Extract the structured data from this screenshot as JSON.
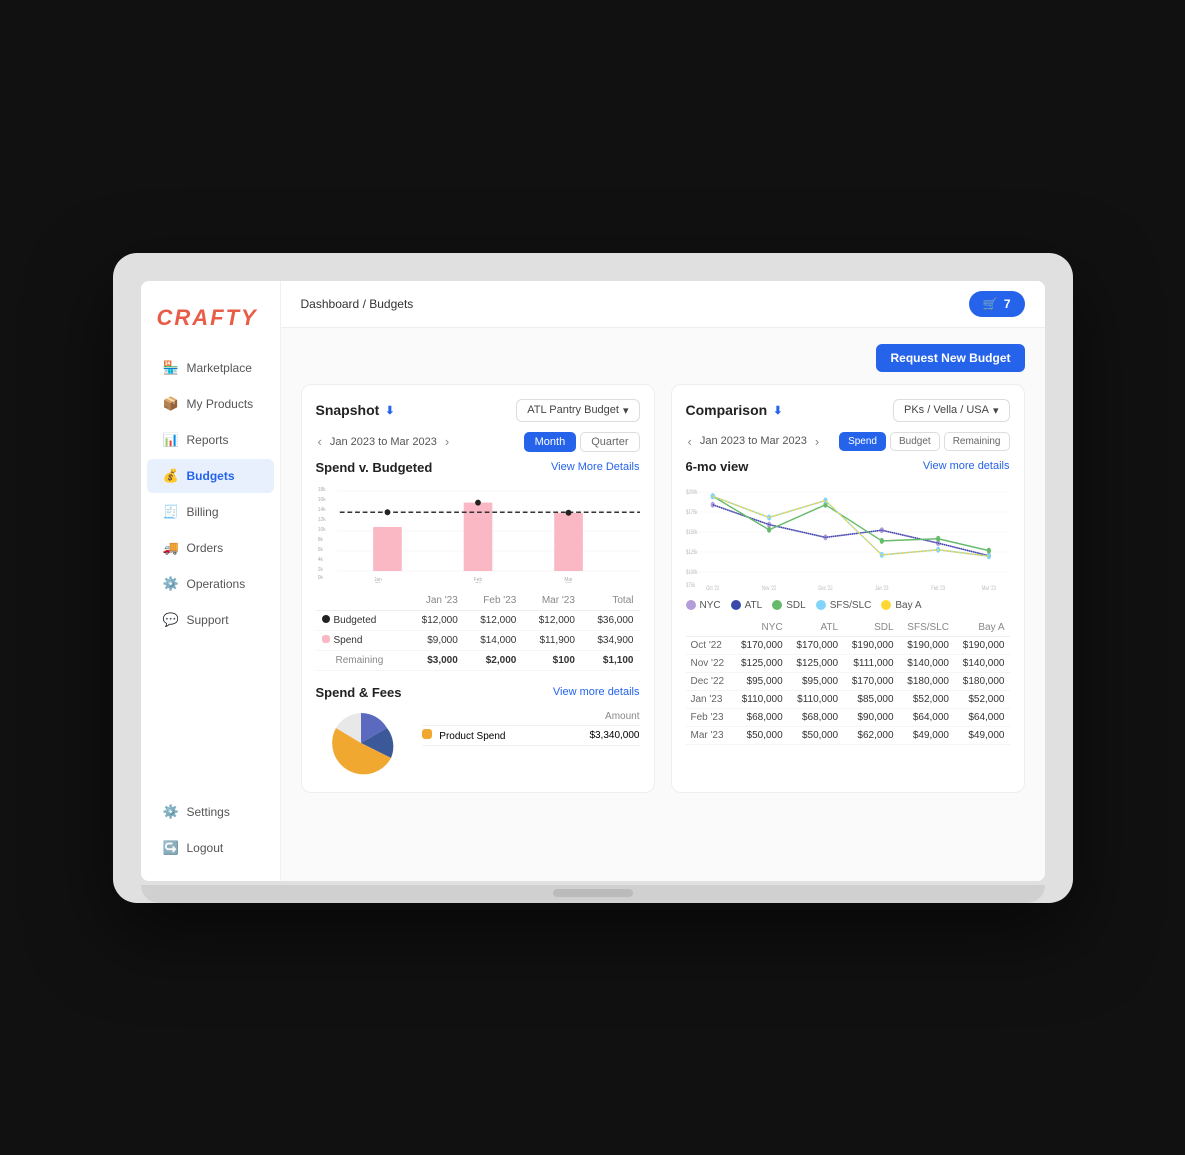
{
  "app": {
    "logo": "CRAFTY",
    "cart_count": "7"
  },
  "sidebar": {
    "nav_items": [
      {
        "id": "marketplace",
        "label": "Marketplace",
        "icon": "🏪",
        "active": false
      },
      {
        "id": "my-products",
        "label": "My Products",
        "icon": "📦",
        "active": false
      },
      {
        "id": "reports",
        "label": "Reports",
        "icon": "📊",
        "active": false
      },
      {
        "id": "budgets",
        "label": "Budgets",
        "icon": "💰",
        "active": true
      },
      {
        "id": "billing",
        "label": "Billing",
        "icon": "🧾",
        "active": false
      },
      {
        "id": "orders",
        "label": "Orders",
        "icon": "🚚",
        "active": false
      },
      {
        "id": "operations",
        "label": "Operations",
        "icon": "⚙️",
        "active": false
      },
      {
        "id": "support",
        "label": "Support",
        "icon": "💬",
        "active": false
      }
    ],
    "bottom_items": [
      {
        "id": "settings",
        "label": "Settings",
        "icon": "⚙️"
      },
      {
        "id": "logout",
        "label": "Logout",
        "icon": "↪️"
      }
    ]
  },
  "breadcrumb": {
    "parent": "Dashboard",
    "separator": "/",
    "current": "Budgets"
  },
  "header": {
    "request_btn": "Request New Budget"
  },
  "snapshot": {
    "title": "Snapshot",
    "download_label": "⬇",
    "dropdown_label": "ATL Pantry Budget",
    "date_range": "Jan 2023  to  Mar 2023",
    "tabs": [
      "Month",
      "Quarter"
    ],
    "active_tab": "Month",
    "chart_title": "Spend v. Budgeted",
    "view_more": "View More Details",
    "table": {
      "columns": [
        "",
        "Jan '23",
        "Feb '23",
        "Mar '23",
        "Total"
      ],
      "rows": [
        {
          "label": "Budgeted",
          "type": "budgeted",
          "jan": "$12,000",
          "feb": "$12,000",
          "mar": "$12,000",
          "total": "$36,000"
        },
        {
          "label": "Spend",
          "type": "spend",
          "jan": "$9,000",
          "feb": "$14,000",
          "mar": "$11,900",
          "total": "$34,900"
        },
        {
          "label": "Remaining",
          "type": "remaining",
          "jan": "$3,000",
          "feb": "$2,000",
          "mar": "$100",
          "total": "$1,100"
        }
      ]
    },
    "bar_data": [
      {
        "month": "Jan '23",
        "budgeted": 12000,
        "spend": 9000
      },
      {
        "month": "Feb '23",
        "budgeted": 12000,
        "spend": 14000
      },
      {
        "month": "Mar '23",
        "budgeted": 12000,
        "spend": 11900
      }
    ],
    "y_labels": [
      "18k",
      "16k",
      "14k",
      "12k",
      "10k",
      "8k",
      "6k",
      "4k",
      "2k",
      "0k"
    ]
  },
  "spend_fees": {
    "title": "Spend & Fees",
    "view_more": "View more details",
    "amount_label": "Amount",
    "rows": [
      {
        "color": "#f0a830",
        "label": "Product Spend",
        "amount": "$3,340,000"
      }
    ],
    "pie_segments": [
      {
        "color": "#5b6abf",
        "percent": 35
      },
      {
        "color": "#3b5998",
        "percent": 20
      },
      {
        "color": "#f0a830",
        "percent": 30
      },
      {
        "color": "#e8e8e8",
        "percent": 15
      }
    ]
  },
  "comparison": {
    "title": "Comparison",
    "download_label": "⬇",
    "dropdown_label": "PKs / Vella / USA",
    "date_range": "Jan 2023  to  Mar 2023",
    "filter_btns": [
      "Spend",
      "Budget",
      "Remaining"
    ],
    "active_filter": "Spend",
    "chart_title": "6-mo view",
    "view_more": "View more details",
    "legend": [
      {
        "color": "#b39ddb",
        "label": "NYC"
      },
      {
        "color": "#3949ab",
        "label": "ATL"
      },
      {
        "color": "#66bb6a",
        "label": "SDL"
      },
      {
        "color": "#81d4fa",
        "label": "SFS/SLC"
      },
      {
        "color": "#fdd835",
        "label": "Bay A"
      }
    ],
    "table": {
      "columns": [
        "",
        "NYC",
        "ATL",
        "SDL",
        "SFS/SLC",
        "Bay A"
      ],
      "rows": [
        {
          "period": "Oct '22",
          "nyc": "$170,000",
          "atl": "$170,000",
          "sdl": "$190,000",
          "sfs": "$190,000",
          "bay": "$190,000"
        },
        {
          "period": "Nov '22",
          "nyc": "$125,000",
          "atl": "$125,000",
          "sdl": "$111,000",
          "sfs": "$140,000",
          "bay": "$140,000"
        },
        {
          "period": "Dec '22",
          "nyc": "$95,000",
          "atl": "$95,000",
          "sdl": "$170,000",
          "sfs": "$180,000",
          "bay": "$180,000"
        },
        {
          "period": "Jan '23",
          "nyc": "$110,000",
          "atl": "$110,000",
          "sdl": "$85,000",
          "sfs": "$52,000",
          "bay": "$52,000"
        },
        {
          "period": "Feb '23",
          "nyc": "$68,000",
          "atl": "$68,000",
          "sdl": "$90,000",
          "sfs": "$64,000",
          "bay": "$64,000"
        },
        {
          "period": "Mar '23",
          "nyc": "$50,000",
          "atl": "$50,000",
          "sdl": "$62,000",
          "sfs": "$49,000",
          "bay": "$49,000"
        }
      ]
    }
  }
}
